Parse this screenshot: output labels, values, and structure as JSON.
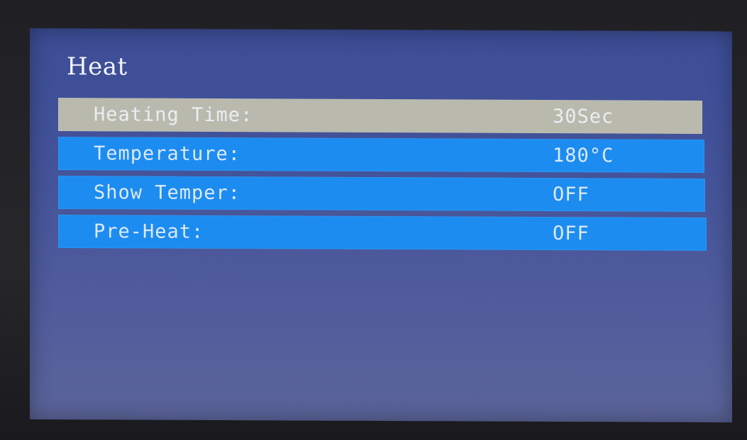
{
  "screen": {
    "title": "Heat"
  },
  "menu": {
    "items": [
      {
        "label": "Heating Time:",
        "value": "30Sec",
        "selected": true
      },
      {
        "label": "Temperature:",
        "value": "180°C",
        "selected": false
      },
      {
        "label": "Show Temper:",
        "value": "OFF",
        "selected": false
      },
      {
        "label": "Pre-Heat:",
        "value": "OFF",
        "selected": false
      }
    ]
  },
  "colors": {
    "background": "#45549a",
    "row": "#1c8cf0",
    "row_selected": "#b9b9ad",
    "text": "#dce9fb"
  }
}
